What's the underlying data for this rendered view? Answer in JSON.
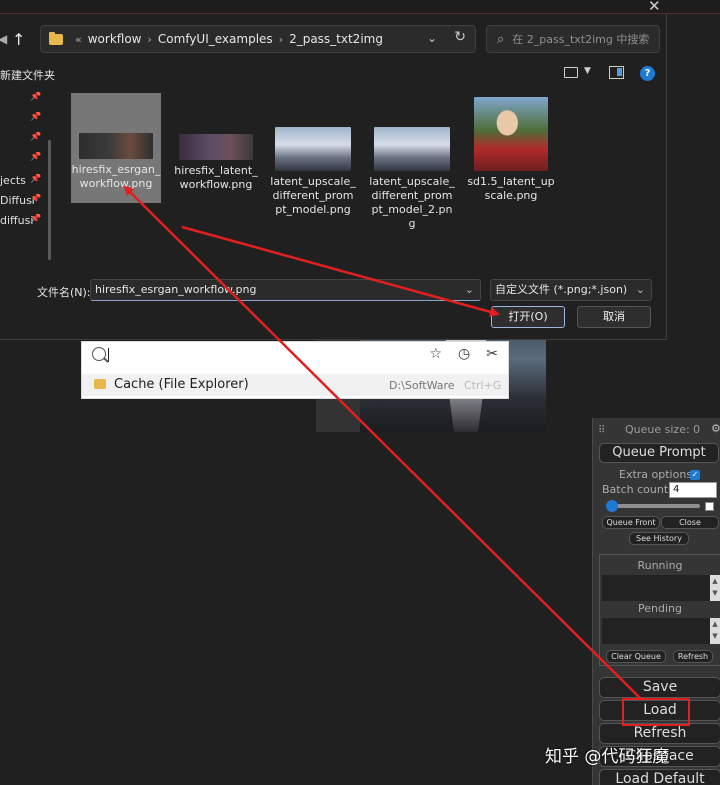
{
  "dialog": {
    "close_glyph": "✕",
    "breadcrumb": [
      "workflow",
      "ComfyUI_examples",
      "2_pass_txt2img"
    ],
    "breadcrumb_overflow": "«",
    "search_placeholder": "在 2_pass_txt2img 中搜索",
    "new_folder": "新建文件夹",
    "sidebar_items": [
      "",
      "",
      "",
      "",
      "jects",
      "Diffusi",
      "diffusi"
    ],
    "files": [
      {
        "name": "hiresfix_esrgan_\nworkflow.png",
        "selected": true
      },
      {
        "name": "hiresfix_latent_\nworkflow.png",
        "selected": false
      },
      {
        "name": "latent_upscale_\ndifferent_prom\npt_model.png",
        "selected": false
      },
      {
        "name": "latent_upscale_\ndifferent_prom\npt_model_2.pn\ng",
        "selected": false
      },
      {
        "name": "sd1.5_latent_up\nscale.png",
        "selected": false
      }
    ],
    "filename_label": "文件名(N):",
    "filename_value": "hiresfix_esrgan_workflow.png",
    "filetype_value": "自定义文件 (*.png;*.json)",
    "open_label": "打开(O)",
    "cancel_label": "取消"
  },
  "popup": {
    "result_title": "Cache (File Explorer)",
    "result_path": "D:\\SoftWare",
    "result_shortcut": "Ctrl+G"
  },
  "queue": {
    "size_label": "Queue size: 0",
    "queue_prompt": "Queue Prompt",
    "extra_options": "Extra options",
    "batch_count_label": "Batch count",
    "batch_count_value": "4",
    "queue_front": "Queue Front",
    "close": "Close",
    "see_history": "See History",
    "running": "Running",
    "pending": "Pending",
    "clear_queue": "Clear Queue",
    "refresh_small": "Refresh",
    "save": "Save",
    "load": "Load",
    "refresh": "Refresh",
    "clipspace": "Clipspace",
    "load_default": "Load Default"
  },
  "watermark": "知乎 @代码狂魔",
  "colors": {
    "annotation": "#e02020",
    "accent": "#1f7ad6"
  }
}
